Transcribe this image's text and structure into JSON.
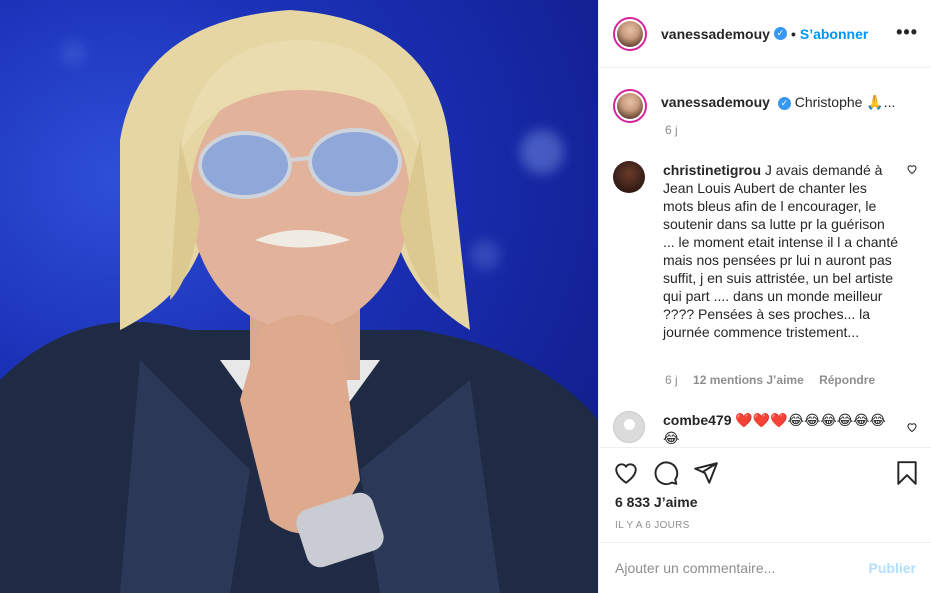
{
  "header": {
    "username": "vanessademouy",
    "follow_label": "S’abonner",
    "more_label": "•••"
  },
  "caption": {
    "username": "vanessademouy",
    "text": "Christophe 🙏...",
    "age": "6 j"
  },
  "comments": [
    {
      "username": "christinetigrou",
      "text": "J avais demandé à Jean Louis Aubert de chanter les mots bleus afin de l encourager, le soutenir dans sa lutte pr la guérison ... le moment etait intense il l a chanté mais nos pensées pr lui n auront pas suffit, j en suis attristée, un bel artiste qui part .... dans un monde meilleur ???? Pensées à ses proches... la journée commence tristement...",
      "age": "6 j",
      "likes": "12 mentions J’aime",
      "reply": "Répondre"
    },
    {
      "username": "combe479",
      "text": "❤️❤️❤️😂😂😂😂😂😂😂"
    }
  ],
  "actions": {
    "likes_count": "6 833 J’aime",
    "date": "IL Y A 6 JOURS"
  },
  "add_comment": {
    "placeholder": "Ajouter un commentaire...",
    "publish_label": "Publier"
  },
  "colors": {
    "accent": "#0095f6",
    "verified": "#3897f0",
    "publish_disabled": "#b2dffc",
    "photo_bg": "#1b32b8"
  },
  "icons": [
    "more-icon",
    "verified-icon",
    "heart-icon",
    "comment-icon",
    "share-icon",
    "bookmark-icon"
  ]
}
